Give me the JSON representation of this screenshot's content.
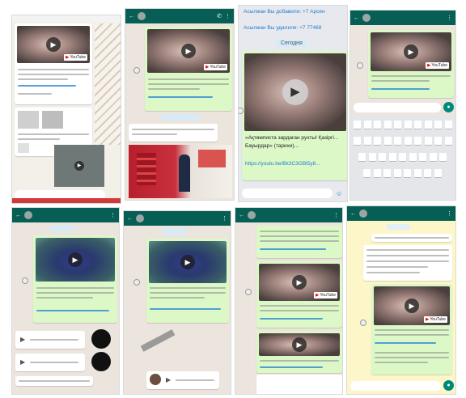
{
  "panels": {
    "p1": {
      "date_pill": ""
    },
    "p2": {
      "title": "",
      "date_pill": ""
    },
    "p3": {
      "top_line1": "Асылжан Вы добавили: +7 Арсен",
      "top_line2": "Асылжан Вы удалили: +7 77468",
      "date_pill": "Сегодня",
      "caption": "«Ақтөмписта зардаған рухты! Қазіргі...",
      "caption2": "Бауырдар» (тарихи)...",
      "link": "https://youtu.be/Bk3C3GBl5y8..."
    },
    "p4": {
      "title": "",
      "keyboard_hint": ""
    },
    "p5": {
      "title": "",
      "date_pill": ""
    },
    "p6": {
      "title": "",
      "date_pill": ""
    },
    "p7": {
      "title": "",
      "caption1": "",
      "caption2": "",
      "caption3": ""
    },
    "p8": {
      "title": "",
      "date_pill": ""
    }
  },
  "colors": {
    "header": "#075e54",
    "bubble_out": "#dcf8c6",
    "bubble_in": "#ffffff",
    "chat_bg": "#ece5dd",
    "p8_bg": "#fdf6c8"
  },
  "icons": [
    "back-arrow-icon",
    "phone-icon",
    "video-call-icon",
    "menu-dots-icon",
    "play-icon",
    "microphone-icon",
    "emoji-icon",
    "attach-icon",
    "camera-icon"
  ]
}
